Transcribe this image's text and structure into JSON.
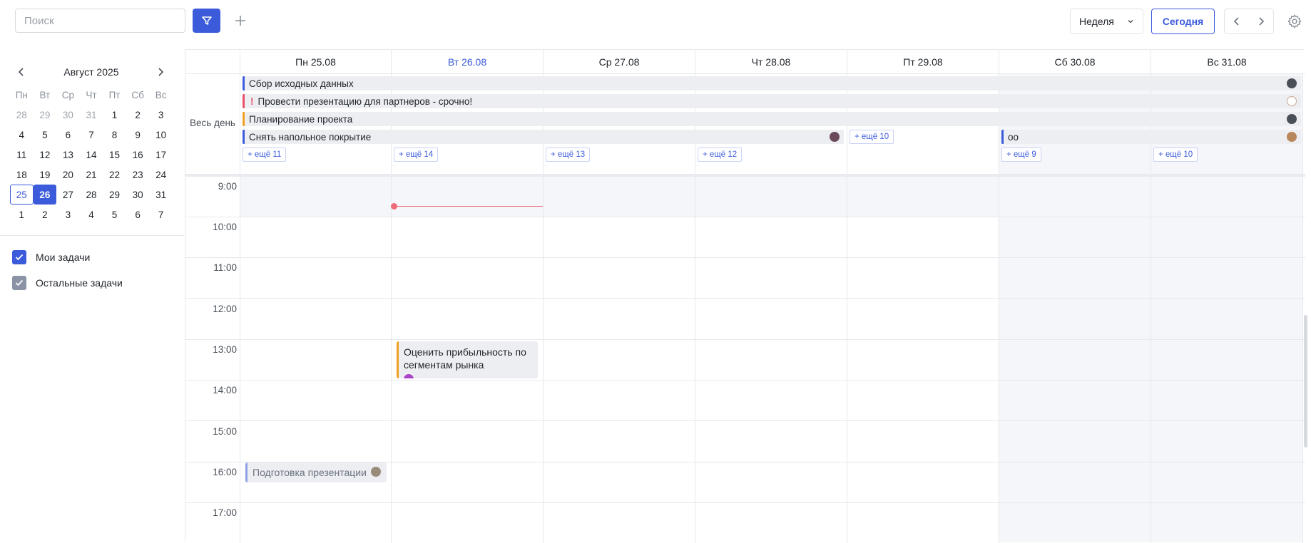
{
  "toolbar": {
    "search_placeholder": "Поиск",
    "view_select": "Неделя",
    "today_label": "Сегодня",
    "accent": "#3b5bdb"
  },
  "minical": {
    "title": "Август 2025",
    "dow": [
      "Пн",
      "Вт",
      "Ср",
      "Чт",
      "Пт",
      "Сб",
      "Вс"
    ],
    "weeks": [
      [
        "28",
        "29",
        "30",
        "31",
        "1",
        "2",
        "3"
      ],
      [
        "4",
        "5",
        "6",
        "7",
        "8",
        "9",
        "10"
      ],
      [
        "11",
        "12",
        "13",
        "14",
        "15",
        "16",
        "17"
      ],
      [
        "18",
        "19",
        "20",
        "21",
        "22",
        "23",
        "24"
      ],
      [
        "25",
        "26",
        "27",
        "28",
        "29",
        "30",
        "31"
      ],
      [
        "1",
        "2",
        "3",
        "4",
        "5",
        "6",
        "7"
      ]
    ]
  },
  "filters": [
    {
      "label": "Мои задачи",
      "checked": true,
      "color": "#3b5bdb"
    },
    {
      "label": "Остальные задачи",
      "checked": true,
      "color": "#8b93a7"
    }
  ],
  "calendar": {
    "days": [
      "Пн 25.08",
      "Вт 26.08",
      "Ср 27.08",
      "Чт 28.08",
      "Пт 29.08",
      "Сб 30.08",
      "Вс 31.08"
    ],
    "allday_label": "Весь день",
    "allday_events": [
      {
        "title": "Сбор исходных данных",
        "color": "#3b5bdb"
      },
      {
        "title": "Провести презентацию для партнеров - срочно!",
        "color": "#e8506a",
        "urgent": "!"
      },
      {
        "title": "Планирование проекта",
        "color": "#f0a020"
      },
      {
        "title": "Снять напольное покрытие",
        "color": "#3b5bdb"
      },
      {
        "title": "оо",
        "color": "#3b5bdb"
      }
    ],
    "more_links": [
      "+ ещё 11",
      "+ ещё 14",
      "+ ещё 13",
      "+ ещё 12",
      "+ ещё 10",
      "+ ещё 9",
      "+ ещё 10"
    ],
    "hours": [
      "9:00",
      "10:00",
      "11:00",
      "12:00",
      "13:00",
      "14:00",
      "15:00",
      "16:00",
      "17:00"
    ],
    "timed_events": [
      {
        "title": "Оценить прибыльность по сегментам рынка",
        "color": "#f0a020"
      },
      {
        "title": "Подготовка презентации",
        "color": "#8fa3e8"
      }
    ]
  }
}
